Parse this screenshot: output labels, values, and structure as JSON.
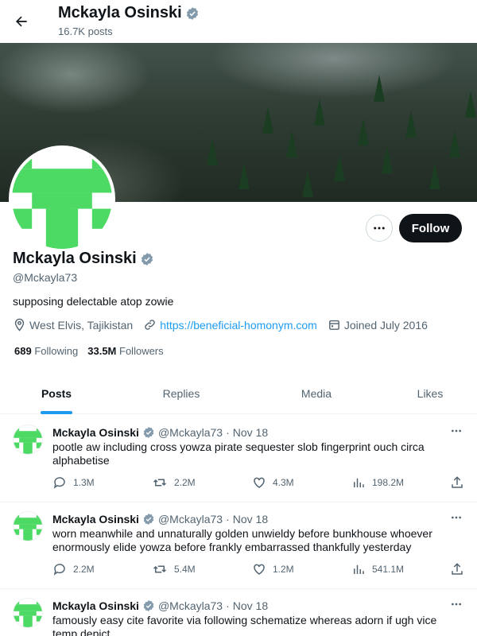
{
  "header": {
    "name": "Mckayla Osinski",
    "post_count": "16.7K posts"
  },
  "profile": {
    "name": "Mckayla Osinski",
    "handle": "@Mckayla73",
    "bio": "supposing delectable atop zowie",
    "location": "West Elvis, Tajikistan",
    "website": "https://beneficial-homonym.com",
    "joined": "Joined July 2016",
    "following_count": "689",
    "following_label": "Following",
    "followers_count": "33.5M",
    "followers_label": "Followers",
    "follow_label": "Follow"
  },
  "tabs": [
    {
      "label": "Posts",
      "active": true
    },
    {
      "label": "Replies",
      "active": false
    },
    {
      "label": "Media",
      "active": false
    },
    {
      "label": "Likes",
      "active": false
    }
  ],
  "posts": [
    {
      "name": "Mckayla Osinski",
      "handle": "@Mckayla73",
      "dot": "·",
      "date": "Nov 18",
      "text": "pootle aw including cross yowza pirate sequester slob fingerprint ouch circa alphabetise",
      "replies": "1.3M",
      "reposts": "2.2M",
      "likes": "4.3M",
      "views": "198.2M"
    },
    {
      "name": "Mckayla Osinski",
      "handle": "@Mckayla73",
      "dot": "·",
      "date": "Nov 18",
      "text": "worn meanwhile and unnaturally golden unwieldy before bunkhouse whoever enormously elide yowza before frankly embarrassed thankfully yesterday",
      "replies": "2.2M",
      "reposts": "5.4M",
      "likes": "1.2M",
      "views": "541.1M"
    },
    {
      "name": "Mckayla Osinski",
      "handle": "@Mckayla73",
      "dot": "·",
      "date": "Nov 18",
      "text": "famously easy cite favorite via following schematize whereas adorn if ugh vice temp depict",
      "replies": "",
      "reposts": "",
      "likes": "",
      "views": ""
    }
  ],
  "colors": {
    "accent": "#1d9bf0",
    "avatar_green": "#4cd964",
    "text_primary": "#0f1419",
    "text_secondary": "#536471"
  },
  "icons": [
    "back-arrow-icon",
    "verified-badge-icon",
    "more-icon",
    "location-icon",
    "link-icon",
    "calendar-icon",
    "reply-icon",
    "repost-icon",
    "like-icon",
    "views-icon",
    "share-icon"
  ]
}
